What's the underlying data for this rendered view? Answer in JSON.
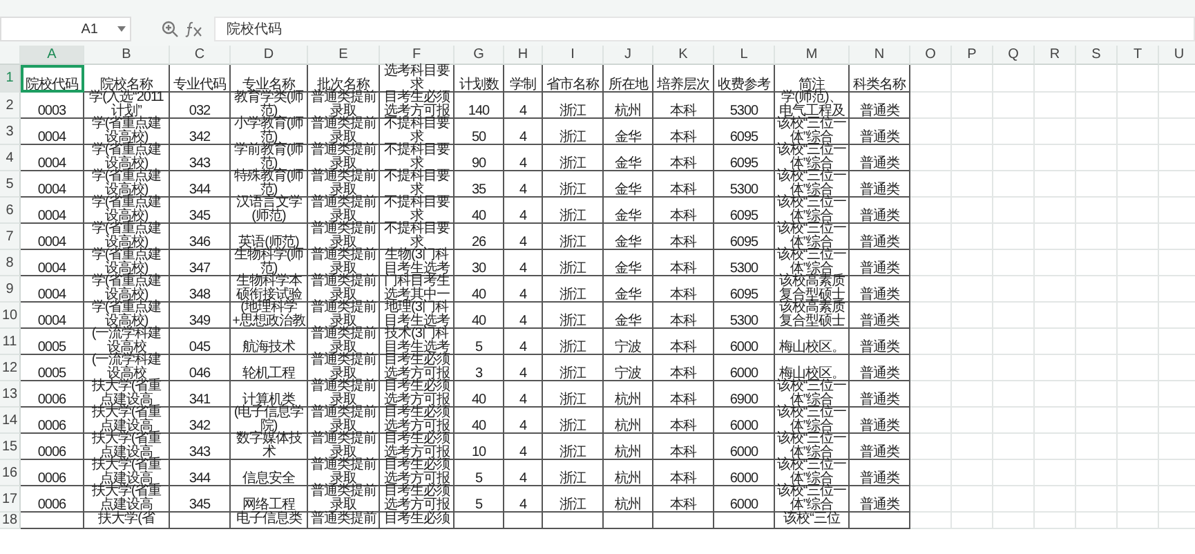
{
  "name_box": "A1",
  "formula": "院校代码",
  "columns": [
    {
      "label": "A",
      "selected": true
    },
    {
      "label": "B",
      "selected": false
    },
    {
      "label": "C",
      "selected": false
    },
    {
      "label": "D",
      "selected": false
    },
    {
      "label": "E",
      "selected": false
    },
    {
      "label": "F",
      "selected": false
    },
    {
      "label": "G",
      "selected": false
    },
    {
      "label": "H",
      "selected": false
    },
    {
      "label": "I",
      "selected": false
    },
    {
      "label": "J",
      "selected": false
    },
    {
      "label": "K",
      "selected": false
    },
    {
      "label": "L",
      "selected": false
    },
    {
      "label": "M",
      "selected": false
    },
    {
      "label": "N",
      "selected": false
    },
    {
      "label": "O",
      "selected": false
    },
    {
      "label": "P",
      "selected": false
    },
    {
      "label": "Q",
      "selected": false
    },
    {
      "label": "R",
      "selected": false
    },
    {
      "label": "S",
      "selected": false
    },
    {
      "label": "T",
      "selected": false
    },
    {
      "label": "U",
      "selected": false
    }
  ],
  "rows": [
    {
      "number": "1",
      "selected": true,
      "cells": [
        "院校代码",
        "院校名称",
        "专业代码",
        "专业名称",
        "批次名称",
        "选考科目要求",
        "计划数",
        "学制",
        "省市名称",
        "所在地",
        "培养层次",
        "收费参考",
        "简注",
        "科类名称"
      ]
    },
    {
      "number": "2",
      "selected": false,
      "cells": [
        "0003",
        "学(入选“2011计划”",
        "032",
        "教育学类(师范)",
        "普通类提前录取",
        "目考生必须选考方可报",
        "140",
        "4",
        "浙江",
        "杭州",
        "本科",
        "5300",
        "学(师范)、电气工程及",
        "普通类"
      ]
    },
    {
      "number": "3",
      "selected": false,
      "cells": [
        "0004",
        "学(省重点建设高校)",
        "342",
        "小学教育(师范)",
        "普通类提前录取",
        "不提科目要求",
        "50",
        "4",
        "浙江",
        "金华",
        "本科",
        "6095",
        "该校“三位一体”综合",
        "普通类"
      ]
    },
    {
      "number": "4",
      "selected": false,
      "cells": [
        "0004",
        "学(省重点建设高校)",
        "343",
        "学前教育(师范)",
        "普通类提前录取",
        "不提科目要求",
        "90",
        "4",
        "浙江",
        "金华",
        "本科",
        "6095",
        "该校“三位一体”综合",
        "普通类"
      ]
    },
    {
      "number": "5",
      "selected": false,
      "cells": [
        "0004",
        "学(省重点建设高校)",
        "344",
        "特殊教育(师范)",
        "普通类提前录取",
        "不提科目要求",
        "35",
        "4",
        "浙江",
        "金华",
        "本科",
        "5300",
        "该校“三位一体”综合",
        "普通类"
      ]
    },
    {
      "number": "6",
      "selected": false,
      "cells": [
        "0004",
        "学(省重点建设高校)",
        "345",
        "汉语言文学(师范)",
        "普通类提前录取",
        "不提科目要求",
        "40",
        "4",
        "浙江",
        "金华",
        "本科",
        "6095",
        "该校“三位一体”综合",
        "普通类"
      ]
    },
    {
      "number": "7",
      "selected": false,
      "cells": [
        "0004",
        "学(省重点建设高校)",
        "346",
        "英语(师范)",
        "普通类提前录取",
        "不提科目要求",
        "26",
        "4",
        "浙江",
        "金华",
        "本科",
        "6095",
        "该校“三位一体”综合",
        "普通类"
      ]
    },
    {
      "number": "8",
      "selected": false,
      "cells": [
        "0004",
        "学(省重点建设高校)",
        "347",
        "生物科学(师范)",
        "普通类提前录取",
        "生物(3门科目考生选考",
        "30",
        "4",
        "浙江",
        "金华",
        "本科",
        "5300",
        "该校“三位一体”综合",
        "普通类"
      ]
    },
    {
      "number": "9",
      "selected": false,
      "cells": [
        "0004",
        "学(省重点建设高校)",
        "348",
        "生物科学本硕衔接试验",
        "普通类提前录取",
        "门科目考生选考其中一",
        "40",
        "4",
        "浙江",
        "金华",
        "本科",
        "6095",
        "该校高素质复合型硕士",
        "普通类"
      ]
    },
    {
      "number": "10",
      "selected": false,
      "cells": [
        "0004",
        "学(省重点建设高校)",
        "349",
        "(地理科学+思想政治教",
        "普通类提前录取",
        "地理(3门科目考生选考",
        "40",
        "4",
        "浙江",
        "金华",
        "本科",
        "5300",
        "该校高素质复合型硕士",
        "普通类"
      ]
    },
    {
      "number": "11",
      "selected": false,
      "cells": [
        "0005",
        "(一流学科建设高校",
        "045",
        "航海技术",
        "普通类提前录取",
        "技术(3门科目考生选考",
        "5",
        "4",
        "浙江",
        "宁波",
        "本科",
        "6000",
        "梅山校区。",
        "普通类"
      ]
    },
    {
      "number": "12",
      "selected": false,
      "cells": [
        "0005",
        "(一流学科建设高校",
        "046",
        "轮机工程",
        "普通类提前录取",
        "目考生必须选考方可报",
        "3",
        "4",
        "浙江",
        "宁波",
        "本科",
        "6000",
        "梅山校区。",
        "普通类"
      ]
    },
    {
      "number": "13",
      "selected": false,
      "cells": [
        "0006",
        "扶大学(省重点建设高",
        "341",
        "计算机类",
        "普通类提前录取",
        "目考生必须选考方可报",
        "40",
        "4",
        "浙江",
        "杭州",
        "本科",
        "6900",
        "该校“三位一体”综合",
        "普通类"
      ]
    },
    {
      "number": "14",
      "selected": false,
      "cells": [
        "0006",
        "扶大学(省重点建设高",
        "342",
        "(电子信息学院)",
        "普通类提前录取",
        "目考生必须选考方可报",
        "40",
        "4",
        "浙江",
        "杭州",
        "本科",
        "6000",
        "该校“三位一体”综合",
        "普通类"
      ]
    },
    {
      "number": "15",
      "selected": false,
      "cells": [
        "0006",
        "扶大学(省重点建设高",
        "343",
        "数字媒体技术",
        "普通类提前录取",
        "目考生必须选考方可报",
        "10",
        "4",
        "浙江",
        "杭州",
        "本科",
        "6000",
        "该校“三位一体”综合",
        "普通类"
      ]
    },
    {
      "number": "16",
      "selected": false,
      "cells": [
        "0006",
        "扶大学(省重点建设高",
        "344",
        "信息安全",
        "普通类提前录取",
        "目考生必须选考方可报",
        "5",
        "4",
        "浙江",
        "杭州",
        "本科",
        "6000",
        "该校“三位一体”综合",
        "普通类"
      ]
    },
    {
      "number": "17",
      "selected": false,
      "cells": [
        "0006",
        "扶大学(省重点建设高",
        "345",
        "网络工程",
        "普通类提前录取",
        "目考生必须选考方可报",
        "5",
        "4",
        "浙江",
        "杭州",
        "本科",
        "6000",
        "该校“三位一体”综合",
        "普通类"
      ]
    },
    {
      "number": "18",
      "selected": false,
      "cells": [
        null,
        "扶大学(省",
        null,
        "电子信息类",
        "普通类提前",
        "目考生必须",
        null,
        null,
        null,
        null,
        null,
        null,
        "该校“三位",
        null
      ]
    }
  ]
}
